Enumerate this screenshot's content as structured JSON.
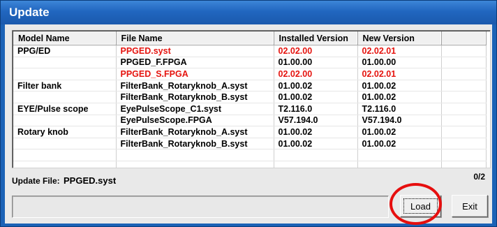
{
  "window": {
    "title": "Update"
  },
  "table": {
    "headers": [
      "Model Name",
      "File Name",
      "Installed Version",
      "New Version",
      ""
    ],
    "rows": [
      {
        "model": "PPG/ED",
        "file": "PPGED.syst",
        "installed": "02.02.00",
        "new": "02.02.01",
        "highlight": true
      },
      {
        "model": "",
        "file": "PPGED_F.FPGA",
        "installed": "01.00.00",
        "new": "01.00.00",
        "highlight": false
      },
      {
        "model": "",
        "file": "PPGED_S.FPGA",
        "installed": "02.02.00",
        "new": "02.02.01",
        "highlight": true
      },
      {
        "model": "Filter bank",
        "file": "FilterBank_Rotaryknob_A.syst",
        "installed": "01.00.02",
        "new": "01.00.02",
        "highlight": false
      },
      {
        "model": "",
        "file": "FilterBank_Rotaryknob_B.syst",
        "installed": "01.00.02",
        "new": "01.00.02",
        "highlight": false
      },
      {
        "model": "EYE/Pulse scope",
        "file": "EyePulseScope_C1.syst",
        "installed": "T2.116.0",
        "new": "T2.116.0",
        "highlight": false
      },
      {
        "model": "",
        "file": "EyePulseScope.FPGA",
        "installed": "V57.194.0",
        "new": "V57.194.0",
        "highlight": false
      },
      {
        "model": "Rotary knob",
        "file": "FilterBank_Rotaryknob_A.syst",
        "installed": "01.00.02",
        "new": "01.00.02",
        "highlight": false
      },
      {
        "model": "",
        "file": "FilterBank_Rotaryknob_B.syst",
        "installed": "01.00.02",
        "new": "01.00.02",
        "highlight": false
      },
      {
        "model": "",
        "file": "",
        "installed": "",
        "new": "",
        "highlight": false
      },
      {
        "model": "",
        "file": "",
        "installed": "",
        "new": "",
        "highlight": false
      },
      {
        "model": "",
        "file": "",
        "installed": "",
        "new": "",
        "highlight": false
      }
    ]
  },
  "update_file": {
    "label": "Update File:",
    "value": "PPGED.syst"
  },
  "counter": "0/2",
  "progress": {
    "value": 0
  },
  "buttons": {
    "load": "Load",
    "exit": "Exit"
  },
  "colors": {
    "highlight_text": "#e5140f",
    "titlebar": "#2166bf",
    "annotation_circle": "#e60e0e"
  }
}
